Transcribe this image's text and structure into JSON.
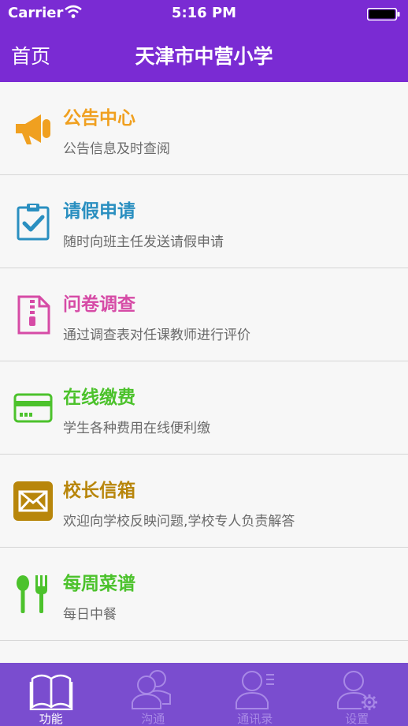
{
  "status_bar": {
    "carrier": "Carrier",
    "time": "5:16 PM"
  },
  "nav": {
    "home_label": "首页",
    "title": "天津市中营小学"
  },
  "items": [
    {
      "title": "公告中心",
      "desc": "公告信息及时查阅",
      "color": "#f0a020",
      "icon": "megaphone-icon"
    },
    {
      "title": "请假申请",
      "desc": "随时向班主任发送请假申请",
      "color": "#2a8fc0",
      "icon": "clipboard-check-icon"
    },
    {
      "title": "问卷调查",
      "desc": "通过调查表对任课教师进行评价",
      "color": "#d64ba6",
      "icon": "questionnaire-file-icon"
    },
    {
      "title": "在线缴费",
      "desc": "学生各种费用在线便利缴",
      "color": "#4cc22c",
      "icon": "credit-card-icon"
    },
    {
      "title": "校长信箱",
      "desc": "欢迎向学校反映问题,学校专人负责解答",
      "color": "#b8860b",
      "icon": "mail-envelope-icon"
    },
    {
      "title": "每周菜谱",
      "desc": "每日中餐",
      "color": "#4cc22c",
      "icon": "spoon-fork-icon"
    }
  ],
  "tabs": [
    {
      "label": "功能",
      "icon": "open-book-icon",
      "active": true
    },
    {
      "label": "沟通",
      "icon": "people-icon",
      "active": false
    },
    {
      "label": "通讯录",
      "icon": "contacts-icon",
      "active": false
    },
    {
      "label": "设置",
      "icon": "settings-person-icon",
      "active": false
    }
  ],
  "colors": {
    "header_bg": "#7a2bd3",
    "tab_bar_bg": "#7a4dcf"
  }
}
